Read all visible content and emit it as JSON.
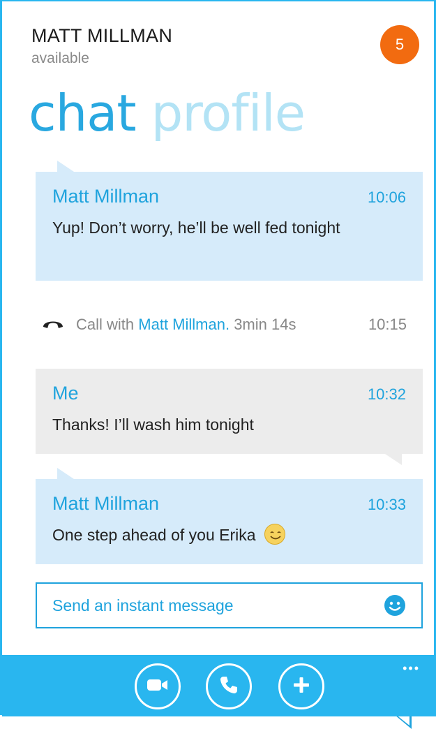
{
  "header": {
    "contact_name": "MATT MILLMAN",
    "status": "available",
    "notification_count": "5"
  },
  "pivot": {
    "active_tab": "chat",
    "inactive_tab": "profile"
  },
  "messages": [
    {
      "sender": "Matt Millman",
      "time": "10:06",
      "text": "Yup! Don’t worry, he’ll be well fed tonight",
      "direction": "incoming"
    },
    {
      "sender": "Me",
      "time": "10:32",
      "text": "Thanks! I’ll wash him tonight",
      "direction": "outgoing"
    },
    {
      "sender": "Matt Millman",
      "time": "10:33",
      "text": "One step ahead of you Erika",
      "direction": "incoming",
      "emoji": "smiley-emoji"
    }
  ],
  "call": {
    "prefix": "Call with",
    "contact": "Matt Millman.",
    "duration": "3min 14s",
    "time": "10:15"
  },
  "compose": {
    "placeholder": "Send an instant message"
  },
  "appbar": {
    "more": "•••",
    "buttons": [
      "video-call-icon",
      "phone-call-icon",
      "add-icon"
    ]
  },
  "colors": {
    "accent": "#29b6ef",
    "link": "#1fa3dd",
    "incoming_bubble": "#d6ebfa",
    "outgoing_bubble": "#ececec",
    "badge": "#f26b10"
  }
}
